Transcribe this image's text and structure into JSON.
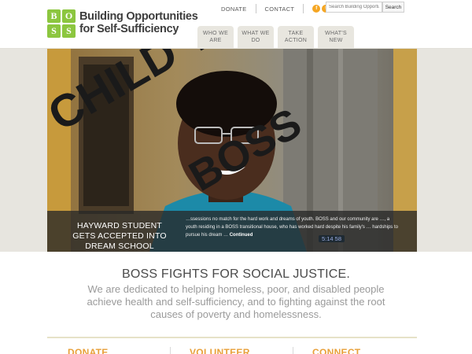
{
  "header": {
    "org_name_line1": "Building Opportunities",
    "org_name_line2": "for Self-Sufficiency",
    "logo_letters": [
      "B",
      "O",
      "S",
      "S"
    ],
    "top_links": {
      "donate": "DONATE",
      "contact": "CONTACT"
    },
    "social_icons": [
      "facebook-icon",
      "twitter-icon",
      "email-icon"
    ],
    "search": {
      "placeholder": "Search Building Opportuni",
      "button_label": "Search"
    },
    "nav": [
      {
        "line1": "WHO WE",
        "line2": "ARE"
      },
      {
        "line1": "WHAT WE",
        "line2": "DO"
      },
      {
        "line1": "TAKE",
        "line2": "ACTION"
      },
      {
        "line1": "WHAT'S",
        "line2": "NEW"
      }
    ]
  },
  "hero": {
    "caption_title": "HAYWARD STUDENT GETS ACCEPTED INTO DREAM SCHOOL",
    "caption_body": "…ssessions no match for the hard work and dreams of youth. BOSS and our community are …, a youth residing in a BOSS transitional house, who has worked hard despite his family's … hardships to pursue his dream …",
    "continued_label": "Continued",
    "overlay_line1": "CHILD THEME",
    "overlay_line2": "BOSS",
    "video_time": "5:14 58"
  },
  "mission": {
    "title": "BOSS FIGHTS FOR SOCIAL JUSTICE.",
    "text": "We are dedicated to helping homeless, poor, and disabled people achieve health and self-sufficiency, and to fighting against the root causes of poverty and homelessness."
  },
  "bottom": {
    "columns": [
      "DONATE",
      "VOLUNTEER",
      "CONNECT"
    ]
  },
  "colors": {
    "logo_green": "#8cc63f",
    "logo_orange": "#f5a623",
    "accent_orange": "#e8a03a",
    "nav_tab": "#e8e6df"
  }
}
